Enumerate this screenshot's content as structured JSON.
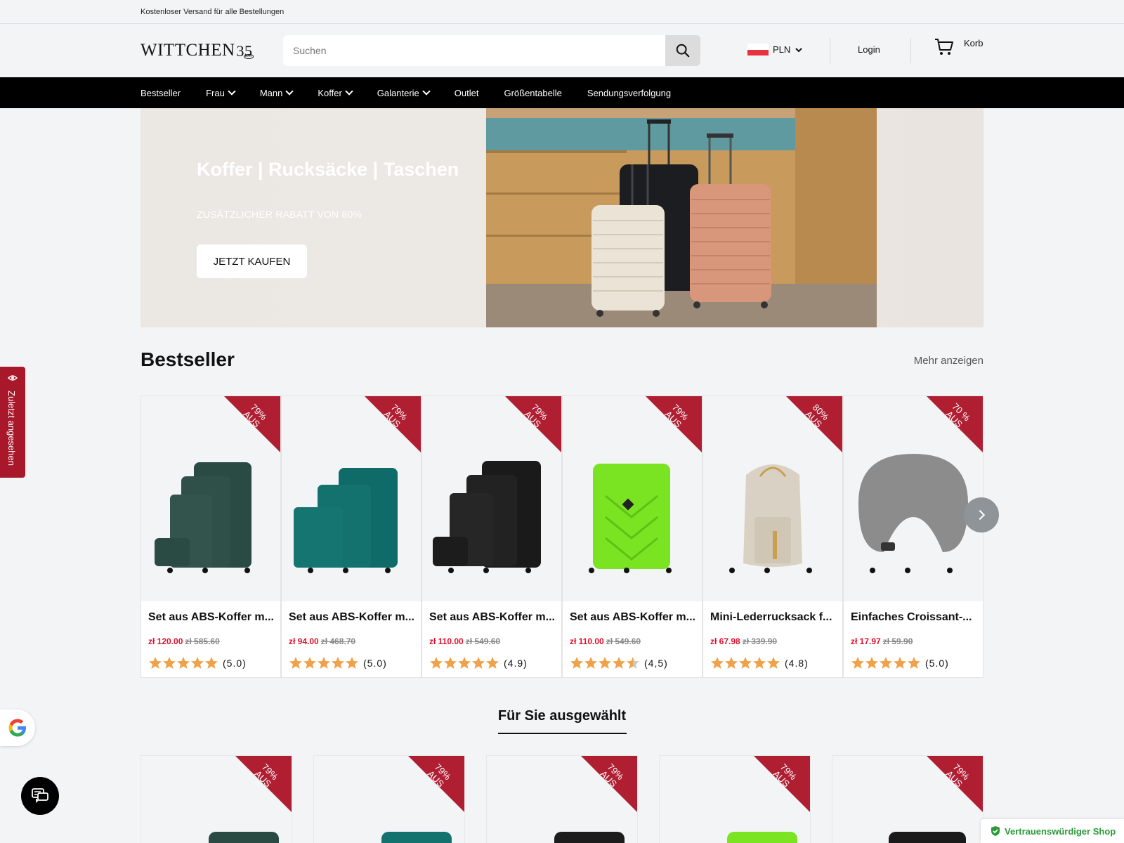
{
  "topbar": {
    "text": "Kostenloser Versand für alle Bestellungen"
  },
  "header": {
    "logo": "WITTCHEN",
    "logo_years": "35",
    "logo_sub": "LAT",
    "search_placeholder": "Suchen",
    "currency": "PLN",
    "login": "Login",
    "cart": "Korb"
  },
  "nav": {
    "items": [
      {
        "label": "Bestseller",
        "dropdown": false
      },
      {
        "label": "Frau",
        "dropdown": true
      },
      {
        "label": "Mann",
        "dropdown": true
      },
      {
        "label": "Koffer",
        "dropdown": true
      },
      {
        "label": "Galanterie",
        "dropdown": true
      },
      {
        "label": "Outlet",
        "dropdown": false
      },
      {
        "label": "Größentabelle",
        "dropdown": false
      },
      {
        "label": "Sendungsverfolgung",
        "dropdown": false
      }
    ]
  },
  "hero": {
    "title": "Koffer | Rucksäcke | Taschen",
    "subtitle": "ZUSÄTZLICHER RABATT VON 80%",
    "button": "JETZT KAUFEN"
  },
  "bestseller": {
    "title": "Bestseller",
    "more": "Mehr anzeigen",
    "products": [
      {
        "name": "Set aus ABS-Koffer m...",
        "discount": "79%\nAUS",
        "price": "zł 120.00",
        "old_price": "zł 585.60",
        "rating": "(5.0)",
        "stars": 5
      },
      {
        "name": "Set aus ABS-Koffer m...",
        "discount": "79%\nAUS",
        "price": "zł 94.00",
        "old_price": "zł 468.70",
        "rating": "(5.0)",
        "stars": 5
      },
      {
        "name": "Set aus ABS-Koffer m...",
        "discount": "79%\nAUS",
        "price": "zł 110.00",
        "old_price": "zł 549.60",
        "rating": "(4.9)",
        "stars": 5
      },
      {
        "name": "Set aus ABS-Koffer m...",
        "discount": "79%\nAUS",
        "price": "zł 110.00",
        "old_price": "zł 549.60",
        "rating": "(4,5)",
        "stars": 4.5
      },
      {
        "name": "Mini-Lederrucksack f...",
        "discount": "80%\nAUS",
        "price": "zł 67.98",
        "old_price": "zł 339.90",
        "rating": "(4.8)",
        "stars": 5
      },
      {
        "name": "Einfaches Croissant-...",
        "discount": "70 %\nAUS",
        "price": "zł 17.97",
        "old_price": "zł 59.90",
        "rating": "(5.0)",
        "stars": 5
      }
    ]
  },
  "selected": {
    "title": "Für Sie ausgewählt",
    "discounts": [
      "79%\nAUS",
      "79%\nAUS",
      "79%\nAUS",
      "79%\nAUS",
      "79%\nAUS"
    ]
  },
  "side_tab": {
    "label": "Zuletzt angesehen"
  },
  "trust_badge": {
    "label": "Vertrauenswürdiger Shop"
  },
  "colors": {
    "accent_red": "#b01e32",
    "price_red": "#e0102a",
    "star": "#f0a24a",
    "trust_green": "#2c9a3a"
  }
}
